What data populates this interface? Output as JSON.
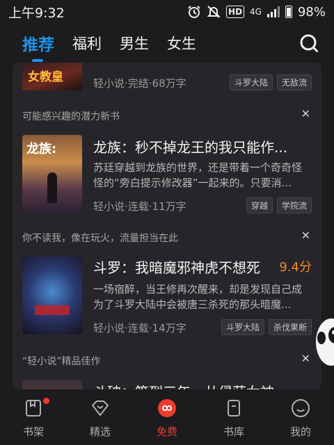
{
  "status_bar": {
    "time": "上午9:32",
    "network": "4G",
    "battery": "98%"
  },
  "tabs": [
    {
      "label": "推荐",
      "active": true
    },
    {
      "label": "福利"
    },
    {
      "label": "男生"
    },
    {
      "label": "女生"
    }
  ],
  "feed": {
    "card0": {
      "cover_text": "女教皇",
      "meta": "轻小说·完结·68万字",
      "tags": [
        "斗罗大陆",
        "无敌流"
      ]
    },
    "card1": {
      "reason": "可能感兴趣的潜力新书",
      "title": "龙族：秒不掉龙王的我只能作...",
      "desc": "苏廷穿越到龙族的世界，还是带着一个奇奇怪怪的“旁白提示修改器”一起来的。只要消...",
      "meta": "轻小说·连载·11万字",
      "tags": [
        "穿越",
        "学院流"
      ],
      "cover_text": "龙族:"
    },
    "card2": {
      "reason": "你不读我，像在玩火，流量担当在此",
      "title": "斗罗：我暗魔邪神虎不想死",
      "score": "9.4分",
      "desc": "一场宿醉，当王修再次醒来，却是发现自己成为了斗罗大陆中会被唐三杀死的那头暗魔...",
      "meta": "轻小说·连载·14万字",
      "tags": [
        "斗罗大陆",
        "杀伐果断"
      ]
    },
    "card3": {
      "reason": "“轻小说”精品佳作",
      "title": "斗破：签到三年，从侵获女神"
    }
  },
  "bottom_nav": [
    {
      "label": "书架"
    },
    {
      "label": "精选"
    },
    {
      "label": "免费",
      "active": true
    },
    {
      "label": "书库"
    },
    {
      "label": "我的"
    }
  ],
  "colors": {
    "accent_blue": "#1e90e8",
    "accent_red": "#ee3b2f",
    "score_orange": "#f08a2c"
  }
}
